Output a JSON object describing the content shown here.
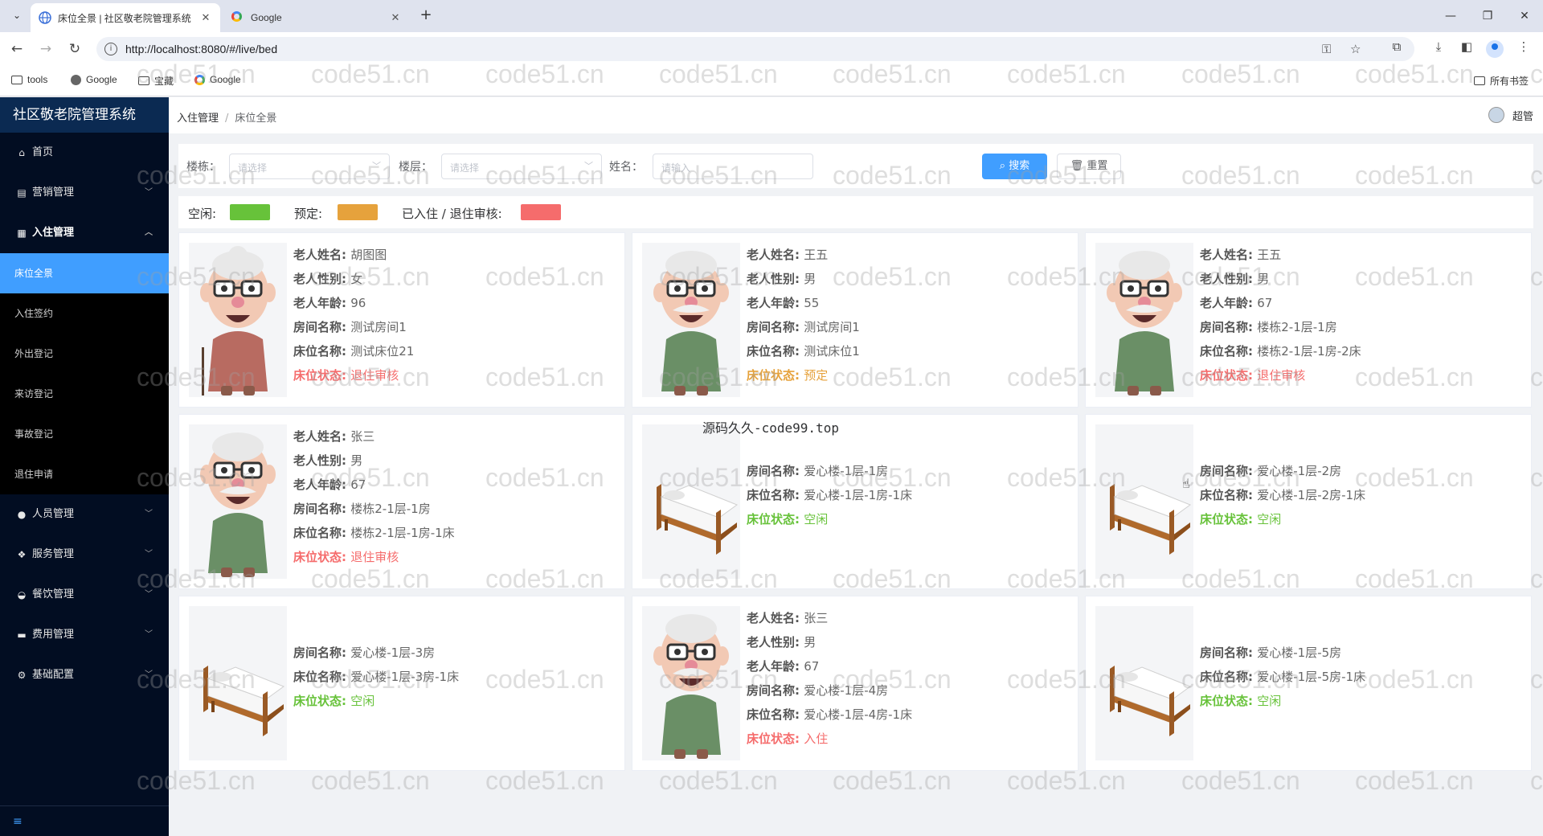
{
  "browser": {
    "tabs": [
      {
        "title": "床位全景 | 社区敬老院管理系统",
        "active": true
      },
      {
        "title": "Google",
        "active": false
      }
    ],
    "url": "http://localhost:8080/#/live/bed",
    "bookmarks": [
      "tools",
      "Google",
      "宝藏",
      "Google"
    ],
    "all_bookmarks": "所有书签"
  },
  "sidebar": {
    "title": "社区敬老院管理系统",
    "items": [
      {
        "label": "首页",
        "icon": "home-icon"
      },
      {
        "label": "营销管理",
        "icon": "chart-icon"
      },
      {
        "label": "入住管理",
        "icon": "building-icon"
      }
    ],
    "sub_items": [
      "床位全景",
      "入住签约",
      "外出登记",
      "来访登记",
      "事故登记",
      "退住申请"
    ],
    "items_after": [
      {
        "label": "人员管理",
        "icon": "user-icon"
      },
      {
        "label": "服务管理",
        "icon": "handshake-icon"
      },
      {
        "label": "餐饮管理",
        "icon": "food-icon"
      },
      {
        "label": "费用管理",
        "icon": "card-icon"
      },
      {
        "label": "基础配置",
        "icon": "gear-icon"
      }
    ]
  },
  "header": {
    "breadcrumb": [
      "入住管理",
      "床位全景"
    ],
    "user": "超管"
  },
  "filter": {
    "building_label": "楼栋：",
    "building_placeholder": "请选择",
    "floor_label": "楼层：",
    "floor_placeholder": "请选择",
    "name_label": "姓名：",
    "name_placeholder": "请输入",
    "search_label": "搜索",
    "reset_label": "重置"
  },
  "legend": [
    {
      "label": "空闲:",
      "color": "#67c23a"
    },
    {
      "label": "预定:",
      "color": "#e6a23c"
    },
    {
      "label": "已入住 / 退住审核:",
      "color": "#f56c6c"
    }
  ],
  "labels": {
    "name": "老人姓名:",
    "gender": "老人性别:",
    "age": "老人年龄:",
    "room": "房间名称:",
    "bed": "床位名称:",
    "status": "床位状态:"
  },
  "beds": [
    {
      "avatar": "elder-woman",
      "name": "胡图图",
      "gender": "女",
      "age": "96",
      "room": "测试房间1",
      "bed": "测试床位21",
      "status": "退住审核",
      "status_color": "#f56c6c"
    },
    {
      "avatar": "elder-man",
      "name": "王五",
      "gender": "男",
      "age": "55",
      "room": "测试房间1",
      "bed": "测试床位1",
      "status": "预定",
      "status_color": "#e6a23c"
    },
    {
      "avatar": "elder-man",
      "name": "王五",
      "gender": "男",
      "age": "67",
      "room": "楼栋2-1层-1房",
      "bed": "楼栋2-1层-1房-2床",
      "status": "退住审核",
      "status_color": "#f56c6c"
    },
    {
      "avatar": "elder-man",
      "name": "张三",
      "gender": "男",
      "age": "67",
      "room": "楼栋2-1层-1房",
      "bed": "楼栋2-1层-1房-1床",
      "status": "退住审核",
      "status_color": "#f56c6c"
    },
    {
      "avatar": "bed",
      "room": "爱心楼-1层-1房",
      "bed": "爱心楼-1层-1房-1床",
      "status": "空闲",
      "status_color": "#67c23a"
    },
    {
      "avatar": "bed",
      "room": "爱心楼-1层-2房",
      "bed": "爱心楼-1层-2房-1床",
      "status": "空闲",
      "status_color": "#67c23a"
    },
    {
      "avatar": "bed",
      "room": "爱心楼-1层-3房",
      "bed": "爱心楼-1层-3房-1床",
      "status": "空闲",
      "status_color": "#67c23a"
    },
    {
      "avatar": "elder-man",
      "name": "张三",
      "gender": "男",
      "age": "67",
      "room": "爱心楼-1层-4房",
      "bed": "爱心楼-1层-4房-1床",
      "status": "入住",
      "status_color": "#f56c6c"
    },
    {
      "avatar": "bed",
      "room": "爱心楼-1层-5房",
      "bed": "爱心楼-1层-5房-1床",
      "status": "空闲",
      "status_color": "#67c23a"
    }
  ],
  "overlay_text": "源码久久-code99.top",
  "watermark": "code51.cn"
}
